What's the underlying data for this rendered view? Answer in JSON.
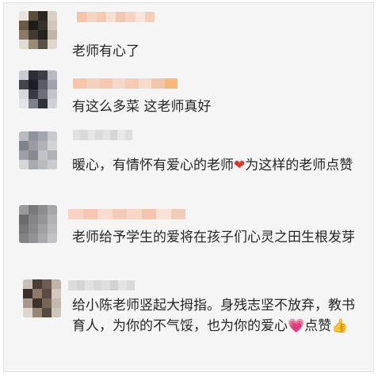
{
  "comments": [
    {
      "avatar_desc": "blurred-photo",
      "nickname": "",
      "text": "老师有心了",
      "palette": [
        "#e9e5de",
        "#5b4b3c",
        "#2a2620",
        "#d7d0c6",
        "#6d5a44",
        "#1e1c18",
        "#3a332b",
        "#cfc7b9",
        "#8a7a66",
        "#42392f",
        "#252220",
        "#bfb6a6",
        "#e2ddd4",
        "#9a8b77",
        "#5a5045",
        "#ddd7cd"
      ],
      "nick_colors": [
        "#f7c4a8",
        "#f3d6c2",
        "#f5cbb0",
        "#f8e0d0",
        "#f2c9b0",
        "#f6d4bf",
        "#f9e6da",
        "#f4cfb8"
      ]
    },
    {
      "avatar_desc": "blurred-photo",
      "nickname": "",
      "text": "有这么多菜 这老师真好",
      "palette": [
        "#c9cbd0",
        "#2c2e35",
        "#3c3e46",
        "#b7bac1",
        "#44464d",
        "#1b1d22",
        "#5a5c64",
        "#9fa2aa",
        "#d6d8dc",
        "#393b42",
        "#6d6f77",
        "#c3c5cb",
        "#e3e4e7",
        "#7e8189",
        "#2f3138",
        "#cfd1d6"
      ],
      "nick_colors": [
        "#f6c6a9",
        "#f4d2bc",
        "#f7c8ad",
        "#f3d9c8",
        "#f5ccb3",
        "#f8dccb",
        "#f2c6ad",
        "#f7b87a"
      ]
    },
    {
      "avatar_desc": "blurred-photo",
      "nickname": "",
      "text_before": "暖心，有情怀有爱心的老师",
      "emoji_heart": "❤",
      "text_after": "为这样的老师点赞",
      "palette": [
        "#b8bcc2",
        "#8f949b",
        "#a3a7ad",
        "#c6c9cd",
        "#7f848b",
        "#999da3",
        "#b0b3b8",
        "#d0d2d5",
        "#9ca0a6",
        "#868a90",
        "#c0c3c7",
        "#aeb1b6",
        "#d5d6d8",
        "#a7aaae",
        "#b9bbbe",
        "#c9cbcd"
      ],
      "nick_colors": [
        "#e0e0e0",
        "#d9d9d9",
        "#e6e6e6",
        "#dcdcdc",
        "#e3e3e3",
        "#d6d6d6",
        "#e8e8e8",
        "#dedede"
      ]
    },
    {
      "avatar_desc": "blurred-photo",
      "nickname": "",
      "text": "老师给予学生的爱将在孩子们心灵之田生根发芽",
      "palette": [
        "#9b9b9d",
        "#7a7a7c",
        "#8d8d8f",
        "#a6a6a8",
        "#6b6b6d",
        "#848486",
        "#959597",
        "#b2b2b4",
        "#777779",
        "#8a8a8c",
        "#a0a0a2",
        "#bababc",
        "#838385",
        "#929294",
        "#a9a9ab",
        "#c2c2c4"
      ],
      "nick_colors": [
        "#f8d3c3",
        "#f6c7b3",
        "#f9dccf",
        "#f4cbb7",
        "#f7d6c6",
        "#f5c4ae",
        "#f9e1d5",
        "#f3cdbb"
      ]
    },
    {
      "avatar_desc": "blurred-photo",
      "nickname": "",
      "text_before": "给小陈老师竖起大拇指。身残志坚不放弃，教书育人，为你的不气馁，也为你的爱心",
      "emoji_heart": "💗",
      "text_after": "点赞",
      "emoji_thumb": "👍",
      "palette": [
        "#c8bfb7",
        "#4a3d35",
        "#6d5d52",
        "#bfb3a9",
        "#3a2f28",
        "#8d7a6c",
        "#5a4b41",
        "#d2c9c1",
        "#a8998c",
        "#3e332c",
        "#766558",
        "#c4b9af",
        "#ddd6cf",
        "#978576",
        "#594a40",
        "#cfc6be"
      ],
      "nick_colors": [
        "#dcdcdc",
        "#d4d4d4",
        "#e2e2e2",
        "#d8d8d8",
        "#dfdfdf",
        "#d2d2d2",
        "#e4e4e4",
        "#dadada"
      ]
    }
  ]
}
